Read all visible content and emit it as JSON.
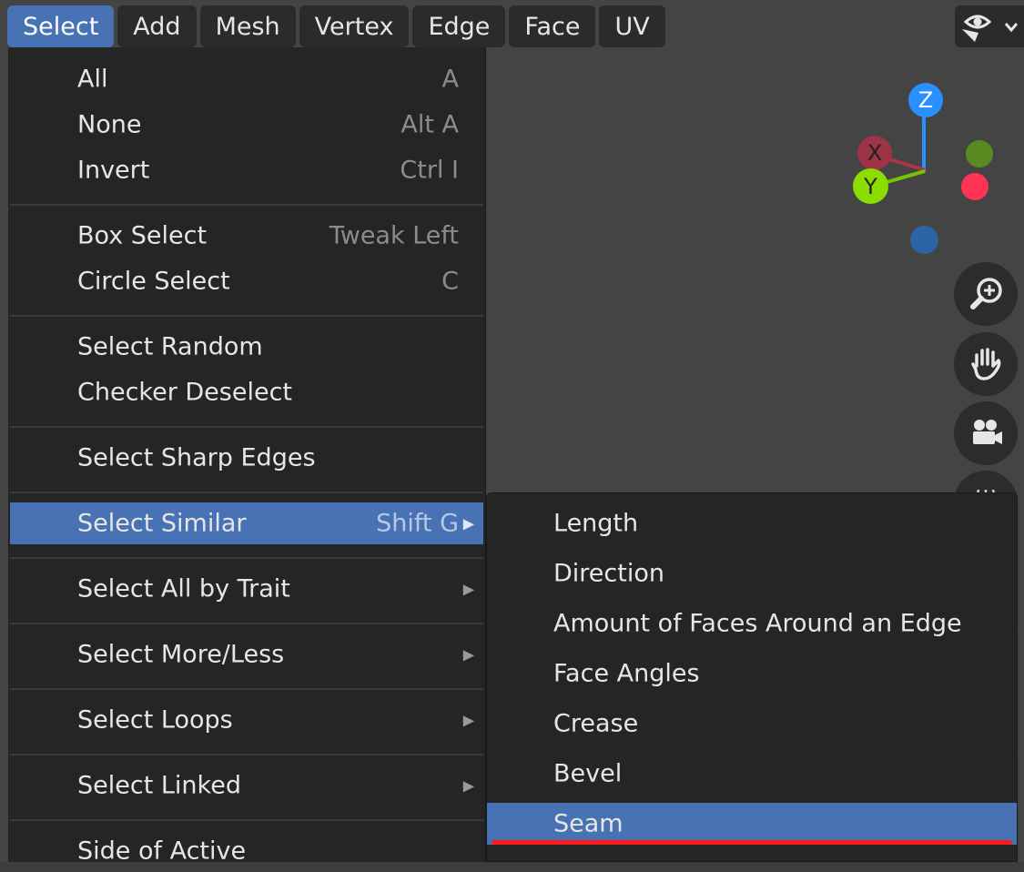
{
  "menubar": {
    "items": [
      {
        "label": "Select",
        "active": true
      },
      {
        "label": "Add"
      },
      {
        "label": "Mesh"
      },
      {
        "label": "Vertex"
      },
      {
        "label": "Edge"
      },
      {
        "label": "Face"
      },
      {
        "label": "UV"
      }
    ],
    "view_icon": "eye-icon"
  },
  "select_menu": {
    "items": [
      {
        "label": "All",
        "shortcut": "A"
      },
      {
        "label": "None",
        "shortcut": "Alt A"
      },
      {
        "label": "Invert",
        "shortcut": "Ctrl I"
      },
      {
        "label": "Box Select",
        "shortcut": "Tweak Left"
      },
      {
        "label": "Circle Select",
        "shortcut": "C"
      },
      {
        "label": "Select Random",
        "shortcut": ""
      },
      {
        "label": "Checker Deselect",
        "shortcut": ""
      },
      {
        "label": "Select Sharp Edges",
        "shortcut": ""
      },
      {
        "label": "Select Similar",
        "shortcut": "Shift G",
        "submenu": true,
        "highlighted": true
      },
      {
        "label": "Select All by Trait",
        "submenu": true
      },
      {
        "label": "Select More/Less",
        "submenu": true
      },
      {
        "label": "Select Loops",
        "submenu": true
      },
      {
        "label": "Select Linked",
        "submenu": true
      },
      {
        "label": "Side of Active",
        "submenu": false
      }
    ]
  },
  "similar_submenu": {
    "items": [
      {
        "label": "Length"
      },
      {
        "label": "Direction"
      },
      {
        "label": "Amount of Faces Around an Edge"
      },
      {
        "label": "Face Angles"
      },
      {
        "label": "Crease"
      },
      {
        "label": "Bevel"
      },
      {
        "label": "Seam",
        "highlighted": true
      }
    ]
  },
  "gizmo": {
    "x_label": "X",
    "y_label": "Y",
    "z_label": "Z",
    "colors": {
      "x": "#ff3352",
      "y": "#8bdc00",
      "z": "#2890ff"
    }
  },
  "nav_icons": [
    "zoom-icon",
    "hand-pan-icon",
    "camera-icon",
    "grid-ortho-icon"
  ],
  "colors": {
    "accent": "#4772b3",
    "menu_bg": "#252525",
    "annotation_red": "#ff1a1a"
  }
}
